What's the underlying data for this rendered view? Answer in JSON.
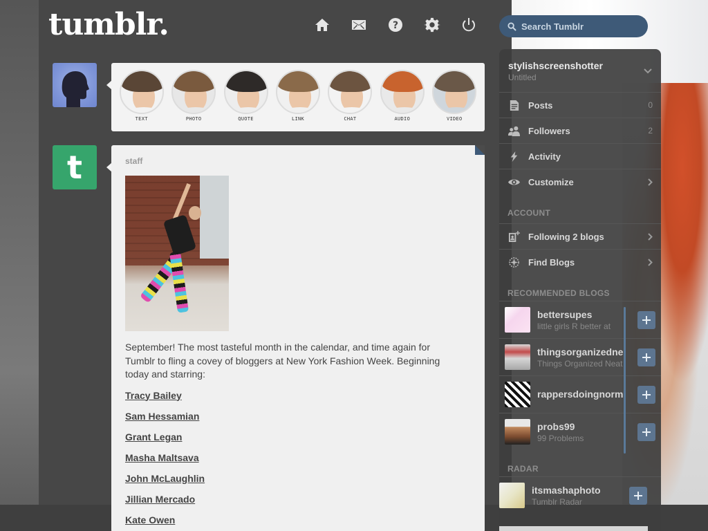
{
  "header": {
    "logo": "tumblr.",
    "search_placeholder": "Search Tumblr",
    "nav_icons": [
      "home-icon",
      "mail-icon",
      "help-icon",
      "gear-icon",
      "power-icon"
    ]
  },
  "post_types": [
    {
      "label": "TEXT",
      "hair": "#5a4636",
      "body": "#f2f2f2"
    },
    {
      "label": "PHOTO",
      "hair": "#7a5a3e",
      "body": "#e7e7e7"
    },
    {
      "label": "QUOTE",
      "hair": "#2e2a28",
      "body": "#ededed"
    },
    {
      "label": "LINK",
      "hair": "#8a6a4a",
      "body": "#f0f0f0"
    },
    {
      "label": "CHAT",
      "hair": "#6c5440",
      "body": "#f3f3f3"
    },
    {
      "label": "AUDIO",
      "hair": "#c8632e",
      "body": "#e9e9e9"
    },
    {
      "label": "VIDEO",
      "hair": "#6a5848",
      "body": "#cfd6dc"
    }
  ],
  "post": {
    "author": "staff",
    "body": "September! The most tasteful month in the calendar, and time again for Tumblr to fling a covey of bloggers at New York Fashion Week. Beginning today and starring:",
    "links": [
      "Tracy Bailey",
      "Sam Hessamian",
      "Grant Legan",
      "Masha Maltsava",
      "John McLaughlin",
      "Jillian Mercado",
      "Kate Owen"
    ]
  },
  "sidebar": {
    "blog_name": "stylishscreenshotter",
    "blog_subtitle": "Untitled",
    "items": [
      {
        "label": "Posts",
        "count": "0",
        "icon": "posts-icon"
      },
      {
        "label": "Followers",
        "count": "2",
        "icon": "followers-icon"
      },
      {
        "label": "Activity",
        "count": "",
        "icon": "activity-icon"
      },
      {
        "label": "Customize",
        "count": "",
        "icon": "eye-icon"
      }
    ],
    "account_heading": "ACCOUNT",
    "account_items": [
      {
        "label": "Following 2 blogs",
        "icon": "following-icon"
      },
      {
        "label": "Find Blogs",
        "icon": "compass-icon"
      }
    ],
    "recommended_heading": "RECOMMENDED BLOGS",
    "recommended": [
      {
        "title": "bettersupes",
        "desc": "little girls R better at"
      },
      {
        "title": "thingsorganizedneatly",
        "desc": "Things Organized Neatly"
      },
      {
        "title": "rappersdoingnormalshit",
        "desc": ""
      },
      {
        "title": "probs99",
        "desc": "99 Problems"
      }
    ],
    "radar_heading": "RADAR",
    "radar": {
      "title": "itsmashaphoto",
      "desc": "Tumblr Radar"
    }
  },
  "colors": {
    "accent": "#3e5a78",
    "staff_avatar": "#36a56c",
    "follow_button": "#5d7590"
  }
}
